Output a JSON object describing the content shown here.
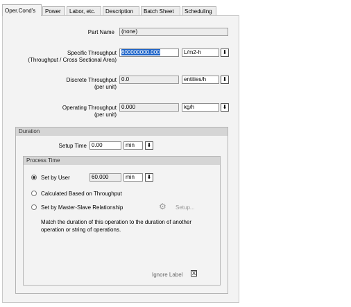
{
  "tabs": [
    "Oper.Cond's",
    "Power",
    "Labor, etc.",
    "Description",
    "Batch Sheet",
    "Scheduling"
  ],
  "part_name": {
    "label": "Part Name",
    "value": "(none)"
  },
  "specific_throughput": {
    "label": "Specific Throughput",
    "sublabel": "(Throughput / Cross Sectional Area)",
    "value": "600000000.000",
    "unit": "L/m2-h"
  },
  "discrete_throughput": {
    "label": "Discrete Throughput",
    "sublabel": "(per unit)",
    "value": "0.0",
    "unit": "entities/h"
  },
  "operating_throughput": {
    "label": "Operating Throughput",
    "sublabel": "(per unit)",
    "value": "0.000",
    "unit": "kg/h"
  },
  "duration": {
    "title": "Duration",
    "setup_time_label": "Setup Time",
    "setup_time_value": "0.00",
    "setup_time_unit": "min"
  },
  "process_time": {
    "title": "Process Time",
    "set_by_user_label": "Set by User",
    "set_by_user_value": "60.000",
    "set_by_user_unit": "min",
    "calculated_label": "Calculated Based on Throughput",
    "master_slave_label": "Set by Master-Slave Relationship",
    "setup_button": "Setup...",
    "description": "Match the duration of this operation to the duration of another operation or string of operations.",
    "ignore_label": "Ignore Label",
    "ignore_checked": "X"
  },
  "icons": {
    "dropdown": "down-arrow-icon",
    "setup": "gear-icon"
  },
  "colors": {
    "selection": "#1c63c9",
    "section_header": "#d5d5d5"
  }
}
